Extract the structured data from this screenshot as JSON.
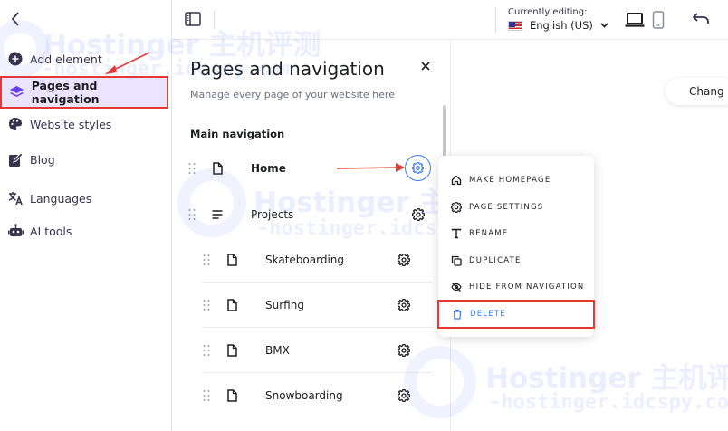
{
  "sidebar": {
    "items": [
      {
        "label": "Add element",
        "icon": "plus-circle-icon"
      },
      {
        "label": "Pages and navigation",
        "icon": "layers-icon",
        "active": true
      },
      {
        "label": "Website styles",
        "icon": "palette-icon"
      },
      {
        "label": "Blog",
        "icon": "edit-icon"
      },
      {
        "label": "Languages",
        "icon": "translate-icon"
      },
      {
        "label": "AI tools",
        "icon": "robot-icon"
      }
    ]
  },
  "topbar": {
    "editing_label": "Currently editing:",
    "language": "English (US)"
  },
  "panel": {
    "title": "Pages and navigation",
    "subtitle": "Manage every page of your website here",
    "section_title": "Main navigation",
    "pages": [
      {
        "label": "Home",
        "type": "page",
        "level": 0
      },
      {
        "label": "Projects",
        "type": "folder",
        "level": 0
      },
      {
        "label": "Skateboarding",
        "type": "page",
        "level": 1
      },
      {
        "label": "Surfing",
        "type": "page",
        "level": 1
      },
      {
        "label": "BMX",
        "type": "page",
        "level": 1
      },
      {
        "label": "Snowboarding",
        "type": "page",
        "level": 1
      }
    ]
  },
  "canvas": {
    "change_button": "Chang"
  },
  "context_menu": {
    "items": [
      {
        "label": "MAKE HOMEPAGE",
        "icon": "home-icon"
      },
      {
        "label": "PAGE SETTINGS",
        "icon": "gear-icon"
      },
      {
        "label": "RENAME",
        "icon": "text-icon"
      },
      {
        "label": "DUPLICATE",
        "icon": "copy-icon"
      },
      {
        "label": "HIDE FROM NAVIGATION",
        "icon": "eye-off-icon"
      },
      {
        "label": "DELETE",
        "icon": "trash-icon"
      }
    ]
  },
  "watermark": {
    "brand": "Hostinger 主机评测",
    "url": "-hostinger.idcspy.com"
  },
  "colors": {
    "accent": "#673de6",
    "active_bg": "#ebe4ff",
    "highlight_border": "#e53935",
    "link_blue": "#3a7bff"
  }
}
